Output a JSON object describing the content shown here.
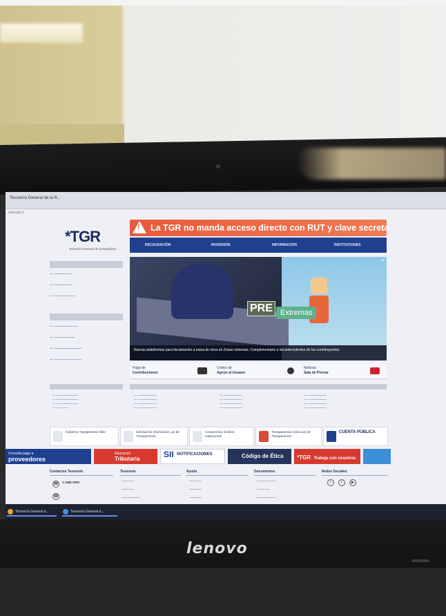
{
  "browser": {
    "tab_title": "Tesorería General de la R...",
    "url": "www.tgr.cl"
  },
  "tgr_site": {
    "logo": "*TGR",
    "logo_sub": "Tesorería General de la República",
    "alert": "La TGR no manda acceso directo con RUT y clave secreta",
    "nav": [
      "RECAUDACIÓN",
      "INVERSIÓN",
      "INFORMACIÓN",
      "INSTITUCIONES"
    ],
    "hero": {
      "pre_label": "PRE",
      "extremas_label": "Extremas",
      "caption": "Nuevas plataformas para fiscalización a masa de otros en Zonas extremas. Complementario a los antecedentes de los contribuyentes."
    },
    "quick_access": {
      "contribuciones_small": "Pago de",
      "contribuciones": "Contribuciones",
      "apoyo_small": "Centro de",
      "apoyo": "Apoyo al Usuario",
      "prensa_small": "Noticias",
      "prensa": "Sala de Prensa"
    },
    "promos": {
      "transparencia": "Gobierno Transparente Chile",
      "ley_transparencia": "Solicitud de Información Ley de Transparencia",
      "gestion": "Compromiso Gestión Institucional",
      "transparencia_activa": "Transparencia Activa Ley de Transparencia",
      "cuenta_publica": "CUENTA PÚBLICA"
    },
    "banners": {
      "proveedores_small": "Consulta pago a",
      "proveedores": "proveedores",
      "educacion_small": "Educación",
      "educacion": "Tributaria",
      "sii": "SII",
      "notificaciones": "NOTIFICACIONES",
      "codigo_etica": "Código de Ética",
      "tgr_small": "*TGR",
      "trabaja": "Trabaja con nosotros"
    },
    "footer": {
      "contacto": "Contactos Tesorería",
      "mesa_ayuda_phone": "2 2386 0000",
      "tesoreria": "Tesorería",
      "ayuda": "Ayuda",
      "documentos": "Documentos",
      "redes": "Redes Sociales"
    }
  },
  "taskbar": {
    "items": [
      "Tesorería General d...",
      "Tesorería General d..."
    ]
  },
  "bezel": {
    "brand": "lenovo"
  }
}
